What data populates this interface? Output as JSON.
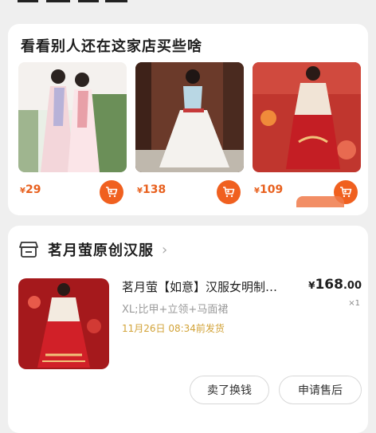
{
  "header": {
    "partial_title": ""
  },
  "recommend": {
    "title": "看看别人还在这家店买些啥",
    "currency": "¥",
    "items": [
      {
        "price": "29"
      },
      {
        "price": "138"
      },
      {
        "price": "109"
      }
    ]
  },
  "order": {
    "store_name": "茗月萤原创汉服",
    "item": {
      "title": "茗月萤【如意】汉服女明制…",
      "currency": "¥",
      "price_int": "168",
      "price_dec": ".00",
      "quantity": "×1",
      "spec": "XL;比甲+立领+马面裙",
      "ship_info": "11月26日  08:34前发货"
    },
    "buttons": {
      "sell": "卖了换钱",
      "after_sale": "申请售后"
    }
  },
  "colors": {
    "accent": "#f0601f",
    "price": "#e8611f",
    "ship": "#d2a338"
  },
  "icons": {
    "cart": "cart-icon",
    "store": "store-icon",
    "chevron": "chevron-right-icon"
  }
}
